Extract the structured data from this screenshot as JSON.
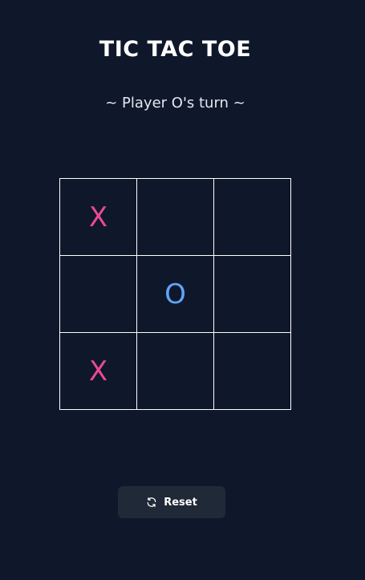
{
  "header": {
    "title": "TIC TAC TOE",
    "status": "~ Player O's turn ~"
  },
  "board": {
    "cells": [
      "X",
      "",
      "",
      "",
      "O",
      "",
      "X",
      "",
      ""
    ]
  },
  "controls": {
    "reset_label": "Reset",
    "reset_icon": "refresh-icon"
  },
  "colors": {
    "background": "#0f172a",
    "x_mark": "#ec4899",
    "o_mark": "#60a5fa",
    "grid_line": "#ffffff",
    "button_bg": "#1f2937"
  }
}
